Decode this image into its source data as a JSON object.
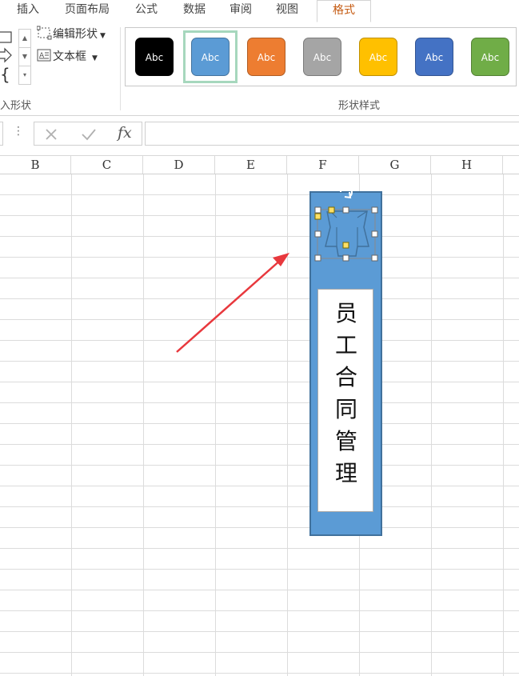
{
  "ribbon_tabs": [
    "插入",
    "页面布局",
    "公式",
    "数据",
    "审阅",
    "视图",
    "格式"
  ],
  "active_tab": "格式",
  "insert_shapes": {
    "edit_shape_label": "编辑形状",
    "textbox_label": "文本框",
    "group_label": "入形状"
  },
  "shape_styles": {
    "group_label": "形状样式",
    "items": [
      {
        "text": "Abc",
        "fill": "#000000"
      },
      {
        "text": "Abc",
        "fill": "#5b9bd5"
      },
      {
        "text": "Abc",
        "fill": "#ed7d31"
      },
      {
        "text": "Abc",
        "fill": "#a5a5a5"
      },
      {
        "text": "Abc",
        "fill": "#ffc000"
      },
      {
        "text": "Abc",
        "fill": "#4472c4"
      },
      {
        "text": "Abc",
        "fill": "#70ad47"
      }
    ],
    "selected_index": 1
  },
  "formula_bar": {
    "fx_label": "fx",
    "value": ""
  },
  "columns": [
    "B",
    "C",
    "D",
    "E",
    "F",
    "G",
    "H"
  ],
  "shape_text": [
    "员",
    "工",
    "合",
    "同",
    "管",
    "理"
  ],
  "colors": {
    "accent_tab": "#c55a11",
    "shape_fill": "#5b9bd5",
    "shape_border": "#41719c",
    "arrow": "#e8383d",
    "selection_outline": "#a6d7bd"
  }
}
